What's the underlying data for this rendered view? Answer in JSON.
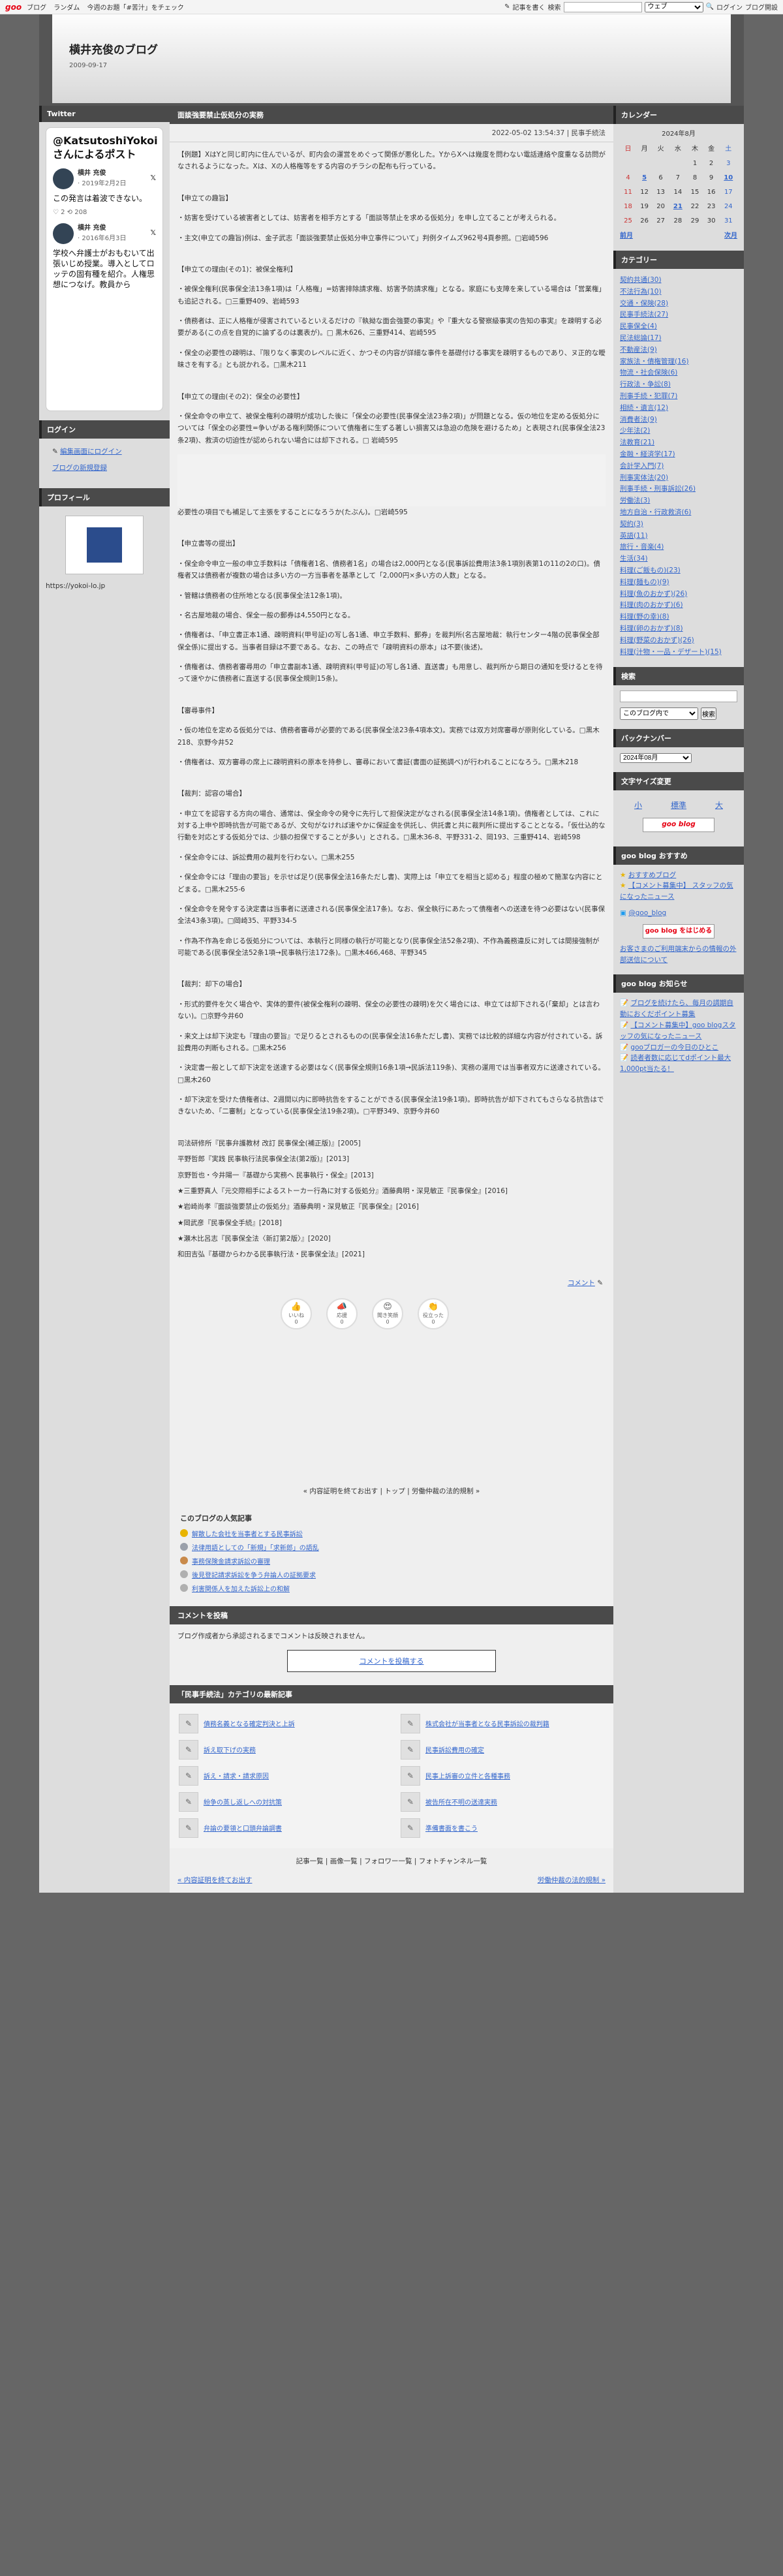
{
  "topbar": {
    "logo": "goo",
    "links": [
      "ブログ",
      "ランダム",
      "今週のお題「#苦汁」をチェック"
    ],
    "post_label": "記事を書く",
    "search_label": "検索",
    "search_scope": "ウェブ",
    "login": "ログイン",
    "blog_start": "ブログ開設"
  },
  "blog": {
    "title": "横井充俊のブログ",
    "date": "2009-09-17"
  },
  "twitter": {
    "heading": "Twitter",
    "card_title": "@KatsutoshiYokoiさんによるポスト",
    "tweets": [
      {
        "name": "横井 充俊",
        "date": "· 2019年2月2日",
        "text": "この発言は着波できない。",
        "meta": "♡ 2  ⟲ 208"
      },
      {
        "name": "横井 充俊",
        "date": "· 2016年6月3日",
        "text": "学校へ弁護士がおもむいて出張いじめ授業。導入としてロッテの固有種を紹介。人権思想につなげ。教員から",
        "meta": ""
      }
    ]
  },
  "login_box": {
    "heading": "ログイン",
    "links": [
      "編集画面にログイン",
      "ブログの新規登録"
    ]
  },
  "profile": {
    "heading": "プロフィール",
    "url": "https://yokoi-lo.jp"
  },
  "article": {
    "title": "面談強要禁止仮処分の実務",
    "meta": "2022-05-02 13:54:37 | 民事手続法",
    "paragraphs": [
      "【例題】XはYと同じ町内に住んでいるが、町内会の運営をめぐって関係が悪化した。YからXへは幾度を問わない電話連絡や度重なる訪問がなされるようになった。Xは、Xの人格権等をする内容のチラシの配布も行っている。",
      "【申立ての趣旨】",
      "・妨害を受けている被害者としては、妨害者を相手方とする「面談等禁止を求める仮処分」を申し立てることが考えられる。",
      "・主文(申立ての趣旨)例は、金子武志「面談強要禁止仮処分申立事件について」判例タイムズ962号4頁参照。□岩崎596",
      "【申立ての理由(その1)：被保全権利】",
      "・被保全権利(民事保全法13条1項)は「人格権」=妨害排除請求権、妨害予防請求権」となる。家庭にも支障を来している場合は「営業権」も追記される。□三重野409、岩崎593",
      "・債務者は、正に人格権が侵害されているといえるだけの『執拗な面会強要の事実』や『重大なる警察級事実の告知の事実』を疎明する必要がある(この点を自覚的に論ずるのは裏表が)。□ 黒木626、三重野414、岩崎595",
      "・保全の必要性の疎明は、『限りなく事実のレベルに近く、かつその内容が詳細な事件を基礎付ける事実を疎明するものであり、ヌ正的な曖昧さを有する』とも説かれる。□黒木211",
      "【申立ての理由(その2)：保全の必要性】",
      "・保全命令の申立て、被保全権利の疎明が成功した後に「保全の必要性(民事保全法23条2項)」が問題となる。仮の地位を定める仮処分については「保全の必要性=争いがある権利関係について債権者に生ずる著しい損害又は急迫の危険を避けるため」と表現され(民事保全法23条2項)、救済の切迫性が認められない場合には却下される。□ 岩崎595",
      "必要性の項目でも補足して主張をすることになろうか(たぶん)。□岩崎595",
      "【申立書等の提出】",
      "・保全命令申立一般の申立手数料は「債権者1名、債務者1名」の場合は2,000円となる(民事訴訟費用法3条1項別表第1の11の2の口)。債権者又は債務者が複数の場合は多い方の一方当事者を基準として「2,000円×多い方の人数」となる。",
      "・管轄は債務者の住所地となる(民事保全法12条1項)。",
      "・名古屋地裁の場合、保全一般の郵券は4,550円となる。",
      "・債権者は、「申立書正本1通、疎明資料(甲号証)の写し各1通、申立手数料、郵券」を裁判所(名古屋地裁：執行センター4階の民事保全部保全係)に提出する。当事者目録は不要である。なお、この時点で「疎明資料の原本」は不要(後述)。",
      "・債権者は、債務者審尋用の「申立書副本1通、疎明資料(甲号証)の写し各1通、直送書」も用意し、裁判所から期日の通知を受けるとを待って速やかに債務者に直送する(民事保全規則15条)。",
      "【審尋事件】",
      "・仮の地位を定める仮処分では、債務者審尋が必要的である(民事保全法23条4項本文)。実務では双方対席審尋が原則化している。□黒木218、京野今井52",
      "・債権者は、双方審尋の席上に疎明資料の原本を持参し、審尋において書証(書面の証拠調べ)が行われることになろう。□黒木218",
      "【裁判：認容の場合】",
      "・申立てを認容する方向の場合、通常は、保全命令の発令に先行して担保決定がなされる(民事保全法14条1項)。債権者としては、これに対する上申や即時抗告が可能であるが、文句がなければ速やかに保証金を供託し、供託書と共に裁判所に提出することとなる。「仮仕込的な行動を対応とする仮処分では、少額の担保ですることが多い」とされる。□黒木36-8、平野331-2、岡193、三重野414、岩崎598",
      "・保全命令には、訴訟費用の裁判を行わない。□黒木255",
      "・保全命令には「理由の要旨」を示せば足り(民事保全法16条ただし書)、実際上は「申立てを相当と認める」程度の極めて簡潔な内容にとどまる。□黒木255-6",
      "・保全命令を発令する決定書は当事者に送達される(民事保全法17条)。なお、保全執行にあたって債権者への送達を待つ必要はない(民事保全法43条3項)。□岡崎35、平野334-5",
      "・作為不作為を命じる仮処分については、本執行と同様の執行が可能となり(民事保全法52条2項)、不作為義務違反に対しては間接強制が可能である(民事保全法52条1項→民事執行法172条)。□黒木466,468、平野345",
      "【裁判：却下の場合】",
      "・形式的要件を欠く場合や、実体的要件(被保全権利の疎明、保全の必要性の疎明)を欠く場合には、申立ては却下される(「棄却」とは言わない)。□京野今井60",
      "・来文上は却下決定も『理由の要旨』で足りるとされるものの(民事保全法16条ただし書)、実務では比較的詳細な内容が付されている。訴訟費用の判断もされる。□黒木256",
      "・決定書一般として却下決定を送達する必要はなく(民事保全規則16条1項→民訴法119条)、実務の運用では当事者双方に送達されている。□黒木260",
      "・却下決定を受けた債権者は、2週間以内に即時抗告をすることができる(民事保全法19条1項)。即時抗告が却下されてもさらなる抗告はできないため、「二審制」となっている(民事保全法19条2項)。□平野349、京野今井60"
    ],
    "refs": [
      "司法研修所『民事弁護教材 改訂 民事保全(補正版)』[2005]",
      "平野哲郎『実践 民事執行法民事保全法(第2版)』[2013]",
      "京野哲也・今井陽一『基礎から実務へ 民事執行・保全』[2013]",
      "★三重野真人『元交際相手によるストーカー行為に対する仮処分』酒藤典明・深見敏正『民事保全』[2016]",
      "★岩崎尚孝『面談強要禁止の仮処分』酒藤典明・深見敏正『民事保全』[2016]",
      "★岡武彦『民事保全手続』[2018]",
      "★瀬木比呂志『民事保全法〈新訂第2版〉』[2020]",
      "和田吉弘『基礎からわかる民事執行法・民事保全法』[2021]"
    ],
    "comment_label": "コメント",
    "reactions": [
      {
        "icon": "👍",
        "label": "いいね",
        "count": "0"
      },
      {
        "icon": "📣",
        "label": "応援",
        "count": "0"
      },
      {
        "icon": "😍",
        "label": "聞き笑顔",
        "count": "0"
      },
      {
        "icon": "👏",
        "label": "役立った",
        "count": "0"
      }
    ],
    "page_nav": "« 内容証明を終てお出す | トップ | 労働仲裁の法的規制 »"
  },
  "popular": {
    "heading": "このブログの人気記事",
    "items": [
      {
        "label": "解散した会社を当事者とする民事訴訟",
        "color": "#e8b400"
      },
      {
        "label": "法律用語としての「新規」「求新郎」の語乱",
        "color": "#9aa0aa"
      },
      {
        "label": "事務保険金請求訴訟の審理",
        "color": "#c98a4a"
      },
      {
        "label": "後見登記請求訴訟を争う弁論人の証拠要求",
        "color": "#b0b0b0"
      },
      {
        "label": "利害関係人を加えた訴訟上の和解",
        "color": "#b0b0b0"
      }
    ]
  },
  "comment_section": {
    "heading": "コメントを投稿",
    "note": "ブログ作成者から承認されるまでコメントは反映されません。",
    "button": "コメントを投稿する"
  },
  "category_latest": {
    "heading": "「民事手続法」カテゴリの最新記事",
    "items": [
      "債務名義となる確定判決と上訴",
      "株式会社が当事者となる民事訴訟の裁判籍",
      "訴え取下げの実務",
      "民事訴訟費用の確定",
      "訴え・請求・請求原因",
      "民事上訴審の立件と各種事務",
      "紛争の蒸し返しへの対抗策",
      "被告所在不明の送達実務",
      "弁論の要領と口頭弁論調書",
      "準備書面を書こう"
    ]
  },
  "footer": {
    "links": "記事一覧 | 画像一覧 | フォロワー一覧 | フォトチャンネル一覧",
    "prev": "« 内容証明を終てお出す",
    "next": "労働仲裁の法的規制 »"
  },
  "calendar": {
    "heading": "カレンダー",
    "month": "2024年8月",
    "weekdays": [
      "日",
      "月",
      "火",
      "水",
      "木",
      "金",
      "土"
    ],
    "rows": [
      [
        "",
        "",
        "",
        "",
        "1",
        "2",
        "3"
      ],
      [
        "4",
        "5",
        "6",
        "7",
        "8",
        "9",
        "10"
      ],
      [
        "11",
        "12",
        "13",
        "14",
        "15",
        "16",
        "17"
      ],
      [
        "18",
        "19",
        "20",
        "21",
        "22",
        "23",
        "24"
      ],
      [
        "25",
        "26",
        "27",
        "28",
        "29",
        "30",
        "31"
      ]
    ],
    "prev": "前月",
    "next": "次月"
  },
  "categories": {
    "heading": "カテゴリー",
    "items": [
      "契約共通(30)",
      "不法行為(10)",
      "交通・保険(28)",
      "民事手続法(27)",
      "民事保全(4)",
      "民法総論(17)",
      "不動産法(9)",
      "家族法・債権管理(16)",
      "物流・社会保険(6)",
      "行政法・争訟(8)",
      "刑事手続・犯罪(7)",
      "相続・遺言(12)",
      "消費者法(9)",
      "少年法(2)",
      "法教育(21)",
      "金融・経済学(17)",
      "会計学入門(7)",
      "刑事実体法(20)",
      "刑事手続・刑事訴訟(26)",
      "労働法(3)",
      "地方自治・行政救済(6)",
      "契約(3)",
      "英語(11)",
      "旅行・音楽(4)",
      "生活(34)",
      "料理(ご飯もの)(23)",
      "料理(麺もの)(9)",
      "料理(魚のおかず)(26)",
      "料理(肉のおかず)(6)",
      "料理(野の幸)(8)",
      "料理(卵のおかず)(8)",
      "料理(野菜のおかず)(26)",
      "料理(汁物・一品・デザート)(15)"
    ]
  },
  "search": {
    "heading": "検索",
    "scope": "このブログ内で",
    "button": "検索"
  },
  "backnumber": {
    "heading": "バックナンバー",
    "value": "2024年08月"
  },
  "textsize": {
    "heading": "文字サイズ変更",
    "options": [
      "小",
      "標準",
      "大"
    ]
  },
  "goo_logo": "goo blog",
  "recommend": {
    "heading": "goo blog おすすめ",
    "items": [
      "おすすめブログ",
      "【コメント募集中】 スタッフの気になったニュース"
    ],
    "twitter_handle": "@goo_blog",
    "start_btn": "goo blog をはじめる",
    "note": "お客さまのご利用端末からの情報の外部送信について"
  },
  "news": {
    "heading": "goo blog お知らせ",
    "items": [
      "ブログを続けたら、毎月の調期自動におくだポイント募集",
      "【コメント募集中】goo blogスタッフの気になったニュース",
      "gooブロガーの今日のひとこ",
      "読者者数に応じてdポイント最大1,000pt当たる！"
    ]
  },
  "colors": {
    "header_bar": "#4a4a4a",
    "accent_red": "#e60012",
    "link": "#3366cc"
  }
}
